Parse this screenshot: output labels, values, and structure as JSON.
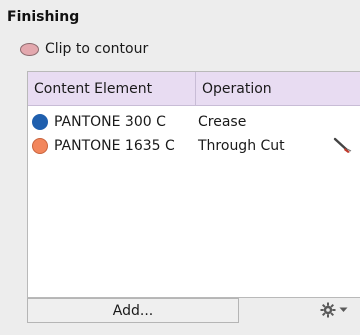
{
  "panel": {
    "title": "Finishing",
    "clip": {
      "label": "Clip to contour"
    }
  },
  "table": {
    "headers": [
      "Content Element",
      "Operation"
    ],
    "rows": [
      {
        "element": "PANTONE 300 C",
        "operation": "Crease",
        "swatch_color": "#1f5fae",
        "tool_icon": ""
      },
      {
        "element": "PANTONE 1635 C",
        "operation": "Through Cut",
        "swatch_color": "#f2865c",
        "tool_icon": "knife-icon"
      }
    ]
  },
  "footer": {
    "add_label": "Add...",
    "settings_icon": "gear-icon"
  },
  "colors": {
    "header_bg": "#e8dcf2",
    "panel_bg": "#ededed",
    "clip_swatch": "#e3a8ae"
  }
}
